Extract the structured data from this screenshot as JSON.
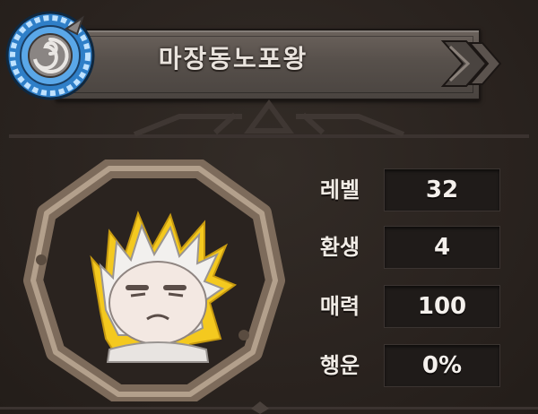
{
  "header": {
    "name": "마장동노포왕",
    "emblem_icon": "swirl-emblem-icon",
    "chevron_icon": "double-chevron-right-icon"
  },
  "portrait": {
    "icon": "white-spiky-hair-character-portrait"
  },
  "stats": [
    {
      "label": "레벨",
      "value": "32"
    },
    {
      "label": "환생",
      "value": "4"
    },
    {
      "label": "매력",
      "value": "100"
    },
    {
      "label": "행운",
      "value": "0%"
    }
  ],
  "colors": {
    "background": "#2a2420",
    "banner": "#57504b",
    "frame": "#8c7a68",
    "emblem_blue": "#3a8fd8",
    "glow": "#f1c21b"
  }
}
